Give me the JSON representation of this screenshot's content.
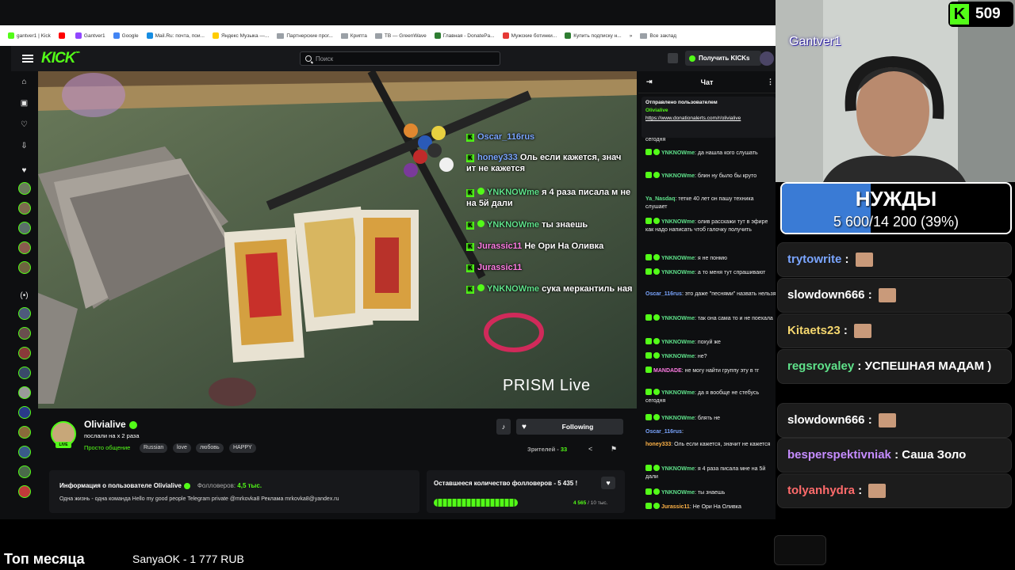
{
  "bookmarks": [
    {
      "label": "gantver1 | Kick",
      "color": "#53fc18"
    },
    {
      "label": "",
      "color": "#ff0000"
    },
    {
      "label": "Gantver1",
      "color": "#9146ff"
    },
    {
      "label": "Google",
      "color": "#4285f4"
    },
    {
      "label": "Mail.Ru: почта, пои...",
      "color": "#168de2"
    },
    {
      "label": "Яндекс Музыка —...",
      "color": "#ffcc00"
    },
    {
      "label": "Партнерские прог...",
      "color": "folder"
    },
    {
      "label": "Крипта",
      "color": "folder"
    },
    {
      "label": "TB — GreenWave",
      "color": "folder"
    },
    {
      "label": "Главная - DonatePa...",
      "color": "#2e7d32"
    },
    {
      "label": "Мужские ботинки...",
      "color": "#e53935"
    },
    {
      "label": "Купить подписку н...",
      "color": "#2e7d32"
    },
    {
      "label": "»",
      "color": "none"
    },
    {
      "label": "Все заклад",
      "color": "folder"
    }
  ],
  "kick": {
    "logo": "KICK",
    "logo_sup": "beta",
    "search_placeholder": "Поиск",
    "get_kicks_label": "Получить KICKs"
  },
  "overlay_chat": [
    {
      "user": "Oscar_116rus",
      "text": "",
      "ucls": "u2"
    },
    {
      "user": "honey333",
      "text": "Оль если кажется, знач ит не кажется",
      "ucls": "u2"
    },
    {
      "user": "YNKNOWme",
      "text": "я 4 раза писала м не на 5й дали",
      "ucls": "u",
      "check": true
    },
    {
      "user": "YNKNOWme",
      "text": "ты знаешь",
      "ucls": "u",
      "check": true
    },
    {
      "user": "Jurassic11",
      "text": "Не Ори На Оливка",
      "ucls": "u3"
    },
    {
      "user": "Jurassic11",
      "text": "",
      "ucls": "u3"
    },
    {
      "user": "YNKNOWme",
      "text": "сука меркантиль ная",
      "ucls": "u",
      "check": true
    }
  ],
  "watermark": "PRISM Live",
  "channel": {
    "name": "Olivialive",
    "title": "послали на х 2 раза",
    "category": "Просто общение",
    "tags": [
      "Russian",
      "love",
      "любовь",
      "HAPPY"
    ],
    "live_badge": "LIVE",
    "follow_label": "Following",
    "viewers_label": "Зрителей -",
    "viewers_count": "33"
  },
  "about": {
    "heading": "Информация о пользователе Olivialive",
    "followers_label": "Фолловеров:",
    "followers_value": "4,5 тыс.",
    "description": "Одна жизнь - одна команда Hello my good people    Telegram private @mrkovka8 Реклама mrkovka8@yandex.ru"
  },
  "goal": {
    "title": "Оставшееся количество фолловеров - 5 435 !",
    "current": "4 565",
    "target": "/ 10 тыс.",
    "progress": 0.4565
  },
  "chat": {
    "header": "Чат",
    "pinned_title": "Отправлено пользователем",
    "pinned_user": "Olivialive",
    "pinned_link": "https://www.donationalerts.com/r/olivialive",
    "messages": [
      {
        "user": "",
        "text": "сегодня",
        "color": "#fff",
        "badges": 0
      },
      {
        "user": "YNKNOWme",
        "text": ": да нашла кого слушать",
        "color": "#5fe28a",
        "badges": 2
      },
      {
        "user": "YNKNOWme",
        "text": ": блин ну было бы круто",
        "color": "#5fe28a",
        "badges": 2
      },
      {
        "user": "Ya_Nasdaq",
        "text": ": тетке 40 лет он пашу техника слушает",
        "color": "#5fe28a",
        "badges": 0
      },
      {
        "user": "YNKNOWme",
        "text": ": олив расскажи тут в эфире как надо написать чтоб галочку получить",
        "color": "#5fe28a",
        "badges": 2
      },
      {
        "user": "YNKNOWme",
        "text": ": я не понмю",
        "color": "#5fe28a",
        "badges": 2
      },
      {
        "user": "YNKNOWme",
        "text": ": а то меня тут спрашивают",
        "color": "#5fe28a",
        "badges": 2
      },
      {
        "user": "Oscar_116rus",
        "text": ": это даже \"песнями\" назвать нельзя",
        "color": "#7aa5ff",
        "badges": 0
      },
      {
        "user": "YNKNOWme",
        "text": ": так она сама то и не поехала",
        "color": "#5fe28a",
        "badges": 2
      },
      {
        "user": "YNKNOWme",
        "text": ": похуй же",
        "color": "#5fe28a",
        "badges": 2
      },
      {
        "user": "YNKNOWme",
        "text": ": не?",
        "color": "#5fe28a",
        "badges": 2
      },
      {
        "user": "MANDADE",
        "text": ": не могу найти группу эту в тг",
        "color": "#ff7ce4",
        "badges": 1
      },
      {
        "user": "YNKNOWme",
        "text": ": да я вообще не стебусь сегодня",
        "color": "#5fe28a",
        "badges": 2
      },
      {
        "user": "YNKNOWme",
        "text": ": блять не",
        "color": "#5fe28a",
        "badges": 2
      },
      {
        "user": "Oscar_116rus",
        "text": ":",
        "color": "#7aa5ff",
        "badges": 0
      },
      {
        "user": "honey333",
        "text": ": Оль если кажется, значит не кажется",
        "color": "#ffb347",
        "badges": 0
      },
      {
        "user": "YNKNOWme",
        "text": ": я 4 раза писала мне на 5й дали",
        "color": "#5fe28a",
        "badges": 2
      },
      {
        "user": "YNKNOWme",
        "text": ": ты знаешь",
        "color": "#5fe28a",
        "badges": 2
      },
      {
        "user": "Jurassic11",
        "text": ": Не Ори На Оливка",
        "color": "#ffb347",
        "badges": 2
      }
    ]
  },
  "stream_overlay": {
    "kick_count": "509",
    "cam_name": "Gantver1",
    "goal_title": "НУЖДЫ",
    "goal_value": "5 600/14 200 (39%)",
    "goal_progress": 0.39,
    "chat": [
      {
        "user": "trytowrite",
        "text": "",
        "color": "#7aa5ff"
      },
      {
        "user": "slowdown666",
        "text": "",
        "color": "#ffffff"
      },
      {
        "user": "Kitaets23",
        "text": "",
        "color": "#f5d76e"
      },
      {
        "user": "regsroyaley",
        "text": "УСПЕШНАЯ МАДАМ )",
        "color": "#5fe28a"
      },
      {
        "user": "slowdown666",
        "text": "",
        "color": "#ffffff"
      },
      {
        "user": "besperspektivniak",
        "text": "Саша Золо",
        "color": "#c58cff"
      },
      {
        "user": "tolyanhydra",
        "text": "",
        "color": "#ff6b6b"
      }
    ]
  },
  "ticker": {
    "title": "Топ месяца",
    "entry": "SanyaOK - 1 777 RUB"
  }
}
